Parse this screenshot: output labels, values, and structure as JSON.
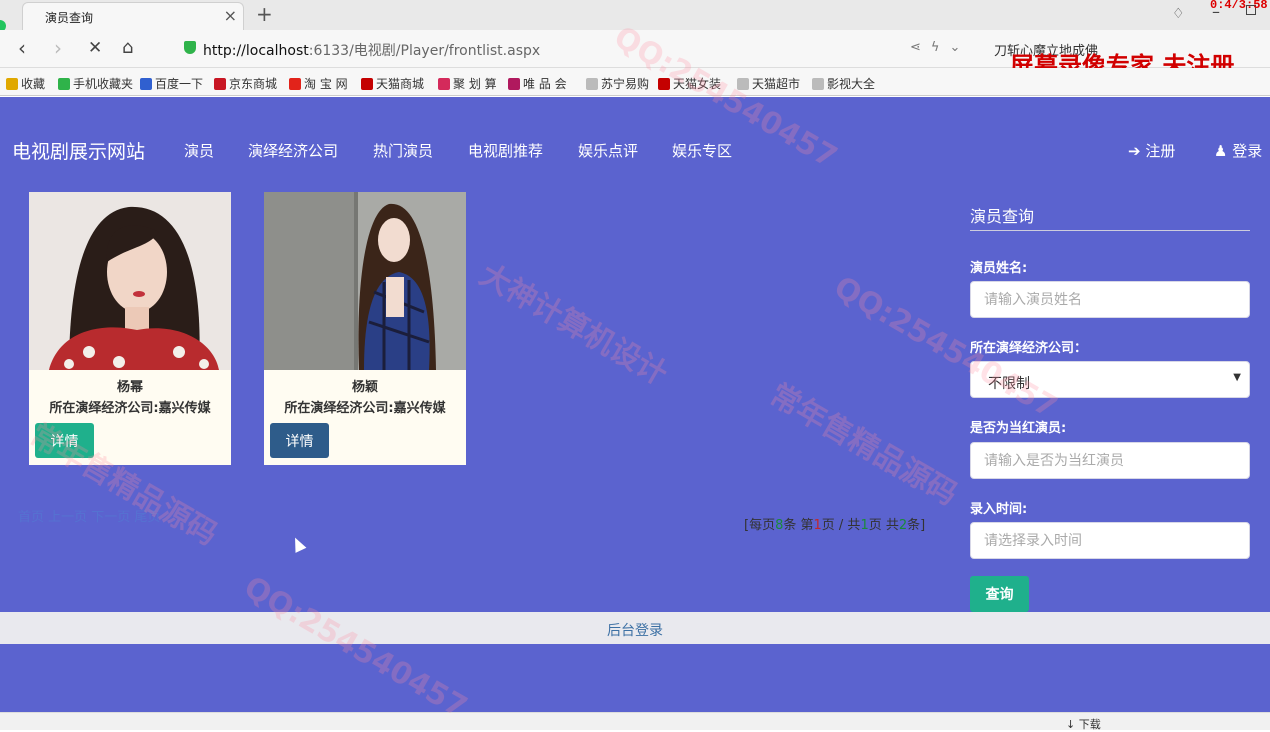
{
  "browser": {
    "tab_title": "演员查询",
    "url_host": "http://localhost",
    "url_rest": ":6133/电视剧/Player/frontlist.aspx",
    "search_text": "刀斩心魔立地成佛",
    "recording_label": "屏幕录像专家 未注册",
    "recording_time": "0:4/3:58",
    "status_download": "下载",
    "bookmarks": [
      {
        "label": "收藏",
        "icon": "star-icon",
        "color": "#e0a800"
      },
      {
        "label": "手机收藏夹",
        "icon": "phone-icon",
        "color": "#2fb34a"
      },
      {
        "label": "百度一下",
        "icon": "baidu-icon",
        "color": "#3060d0"
      },
      {
        "label": "京东商城",
        "icon": "jd-icon",
        "color": "#c81623"
      },
      {
        "label": "淘 宝 网",
        "icon": "taobao-icon",
        "color": "#e2231a"
      },
      {
        "label": "天猫商城",
        "icon": "tmall-icon",
        "color": "#c40000"
      },
      {
        "label": "聚 划 算",
        "icon": "ju-icon",
        "color": "#d42a5b"
      },
      {
        "label": "唯 品 会",
        "icon": "vip-icon",
        "color": "#b0195e"
      },
      {
        "label": "苏宁易购",
        "icon": "page-icon",
        "color": "#bbbbbb"
      },
      {
        "label": "天猫女装",
        "icon": "tmall-icon",
        "color": "#c40000"
      },
      {
        "label": "天猫超市",
        "icon": "page-icon",
        "color": "#bbbbbb"
      },
      {
        "label": "影视大全",
        "icon": "page-icon",
        "color": "#bbbbbb"
      }
    ]
  },
  "site": {
    "brand": "电视剧展示网站",
    "nav": [
      "演员",
      "演绎经济公司",
      "热门演员",
      "电视剧推荐",
      "娱乐点评",
      "娱乐专区"
    ],
    "register": "注册",
    "login": "登录"
  },
  "actors": [
    {
      "name": "杨幂",
      "company": "所在演绎经济公司:嘉兴传媒",
      "button": "详情",
      "button_color": "#1fb08c"
    },
    {
      "name": "杨颖",
      "company": "所在演绎经济公司:嘉兴传媒",
      "button": "详情",
      "button_color": "#2e5c8a"
    }
  ],
  "pager": {
    "prefix": "[每页",
    "per_page": "8",
    "mid1": "条 第",
    "current": "1",
    "mid2": "页 / 共",
    "total_pages": "1",
    "mid3": "页 共",
    "total": "2",
    "suffix": "条]",
    "links": "首页 上一页 下一页 尾页"
  },
  "search": {
    "title": "演员查询",
    "name_label": "演员姓名:",
    "name_placeholder": "请输入演员姓名",
    "company_label": "所在演绎经济公司：",
    "company_value": "不限制",
    "hot_label": "是否为当红演员:",
    "hot_placeholder": "请输入是否为当红演员",
    "time_label": "录入时间:",
    "time_placeholder": "请选择录入时间",
    "query_button": "查询"
  },
  "footer": {
    "admin_login": "后台登录"
  },
  "watermarks": [
    "QQ:254540457",
    "大神计算机设计",
    "常年售精品源码"
  ]
}
